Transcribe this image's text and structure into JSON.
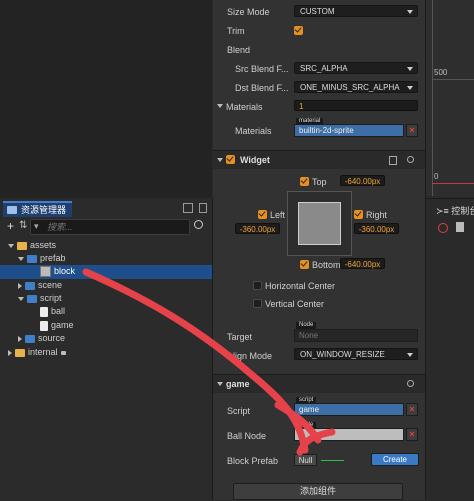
{
  "assets_panel": {
    "tab_label": "资源管理器",
    "search_placeholder": "搜索...",
    "tree": [
      {
        "label": "assets"
      },
      {
        "label": "prefab"
      },
      {
        "label": "block"
      },
      {
        "label": "scene"
      },
      {
        "label": "script"
      },
      {
        "label": "ball"
      },
      {
        "label": "game"
      },
      {
        "label": "source"
      },
      {
        "label": "internal"
      }
    ]
  },
  "inspector": {
    "size_mode_label": "Size Mode",
    "size_mode_value": "CUSTOM",
    "trim_label": "Trim",
    "blend_label": "Blend",
    "src_blend_label": "Src Blend F...",
    "src_blend_value": "SRC_ALPHA",
    "dst_blend_label": "Dst Blend F...",
    "dst_blend_value": "ONE_MINUS_SRC_ALPHA",
    "materials_label": "Materials",
    "materials_count": "1",
    "materials_item_label": "Materials",
    "material_tag": "material",
    "material_value": "builtin-2d-sprite",
    "widget": {
      "title": "Widget",
      "top_label": "Top",
      "top_value": "-640.00px",
      "left_label": "Left",
      "left_value": "-360.00px",
      "right_label": "Right",
      "right_value": "-360.00px",
      "bottom_label": "Bottom",
      "bottom_value": "-640.00px",
      "hcenter_label": "Horizontal Center",
      "vcenter_label": "Vertical Center",
      "target_label": "Target",
      "target_tag": "Node",
      "target_value": "None",
      "align_mode_label": "Align Mode",
      "align_mode_value": "ON_WINDOW_RESIZE"
    },
    "game": {
      "title": "game",
      "script_label": "Script",
      "script_tag": "script",
      "script_value": "game",
      "ball_node_label": "Ball Node",
      "ball_node_tag": "Node",
      "block_prefab_label": "Block Prefab",
      "block_prefab_value": "Null",
      "create_label": "Create"
    },
    "add_component_label": "添加组件"
  },
  "scene": {
    "ruler_500": "500",
    "ruler_0": "0"
  },
  "console": {
    "tab_label": "控制台"
  },
  "colors": {
    "accent_orange": "#e8901f",
    "selection_blue": "#1f4f8a",
    "asset_blue": "#3d6fa6",
    "annotation_red": "#e5424a"
  }
}
